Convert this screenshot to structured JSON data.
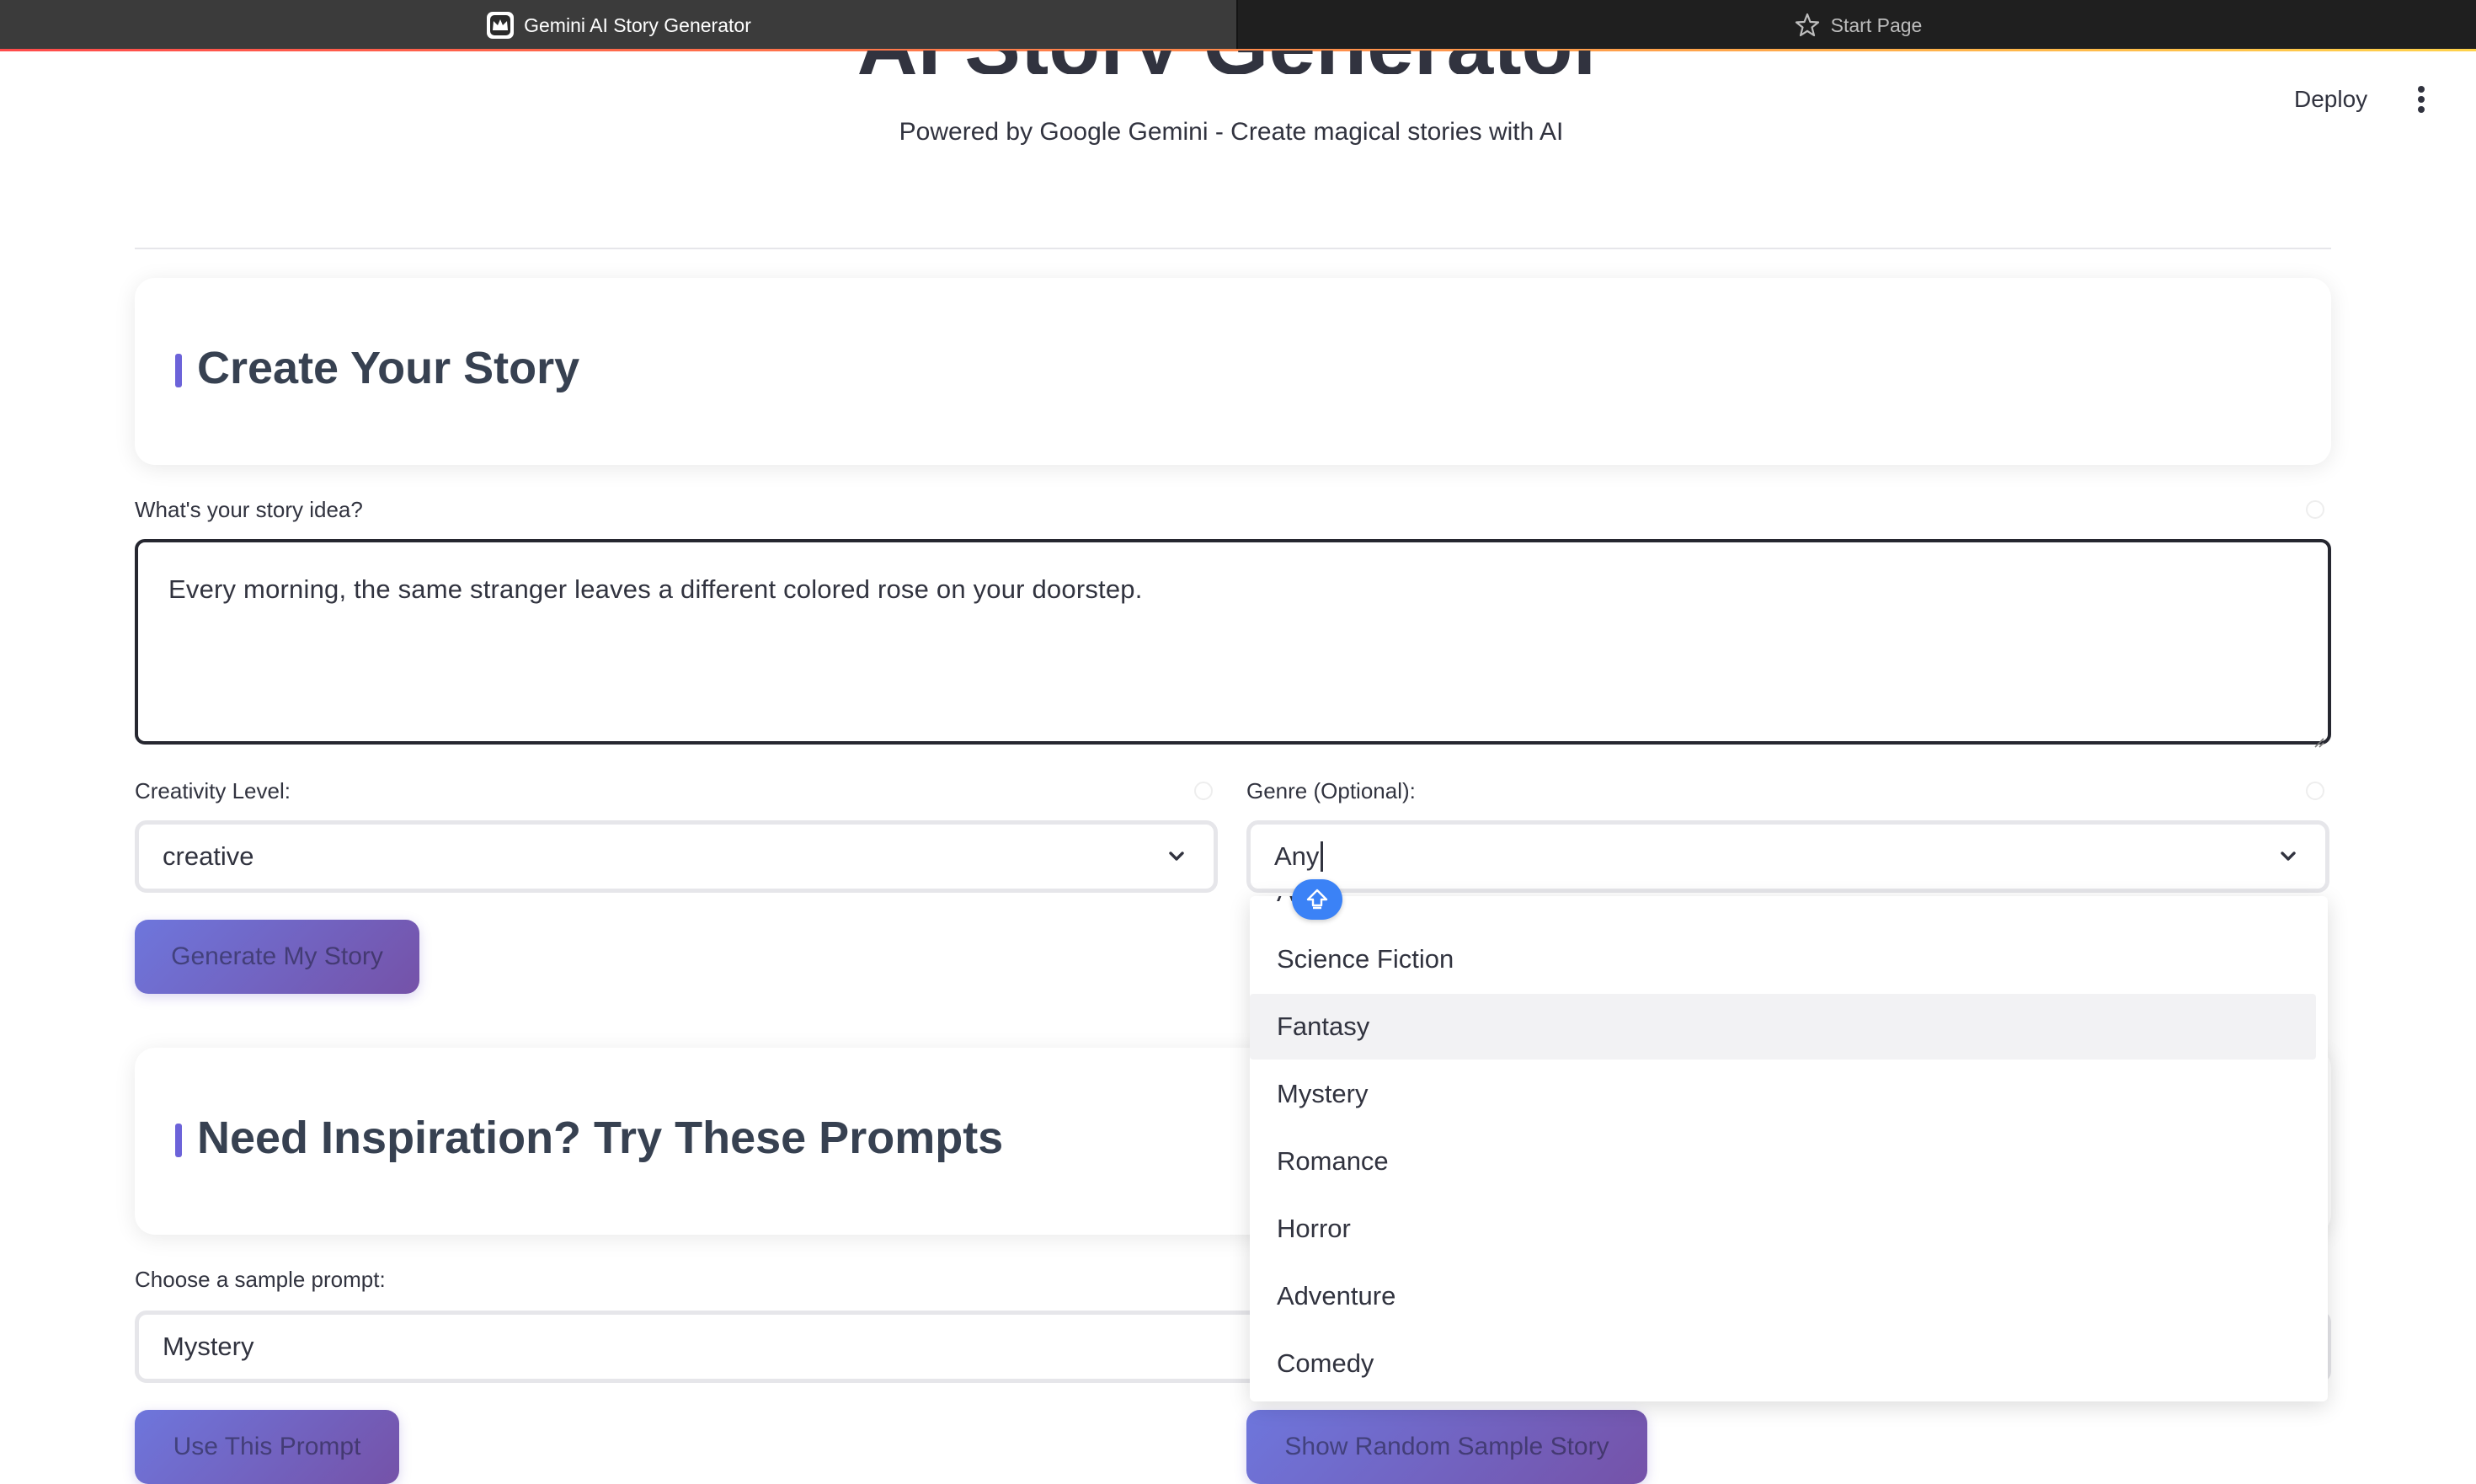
{
  "browser": {
    "tabs": [
      {
        "label": "Gemini AI Story Generator",
        "active": true,
        "icon": "streamlit-crown-icon"
      },
      {
        "label": "Start Page",
        "active": false,
        "icon": "star-icon"
      }
    ]
  },
  "header": {
    "title": "AI Story Generator",
    "subtitle": "Powered by Google Gemini - Create magical stories with AI",
    "deploy_label": "Deploy",
    "menu_icon": "kebab-menu-icon"
  },
  "create_section": {
    "heading": "Create Your Story"
  },
  "story_idea": {
    "label": "What's your story idea?",
    "value": "Every morning, the same stranger leaves a different colored rose on your doorstep."
  },
  "creativity": {
    "label": "Creativity Level:",
    "value": "creative"
  },
  "genre": {
    "label": "Genre (Optional):",
    "value": "Any",
    "partial_option": "A",
    "options": [
      "Science Fiction",
      "Fantasy",
      "Mystery",
      "Romance",
      "Horror",
      "Adventure",
      "Comedy"
    ],
    "highlighted": "Fantasy"
  },
  "generate_button": "Generate My Story",
  "inspiration_section": {
    "heading": "Need Inspiration? Try These Prompts"
  },
  "sample_prompt": {
    "label": "Choose a sample prompt:",
    "value": "Mystery"
  },
  "use_prompt_button": "Use This Prompt",
  "random_sample_button": "Show Random Sample Story",
  "colors": {
    "accent_bar": "#6c63d9",
    "button_gradient_start": "#6e76dc",
    "button_gradient_end": "#7552a8",
    "shift_badge": "#3b82f6"
  }
}
